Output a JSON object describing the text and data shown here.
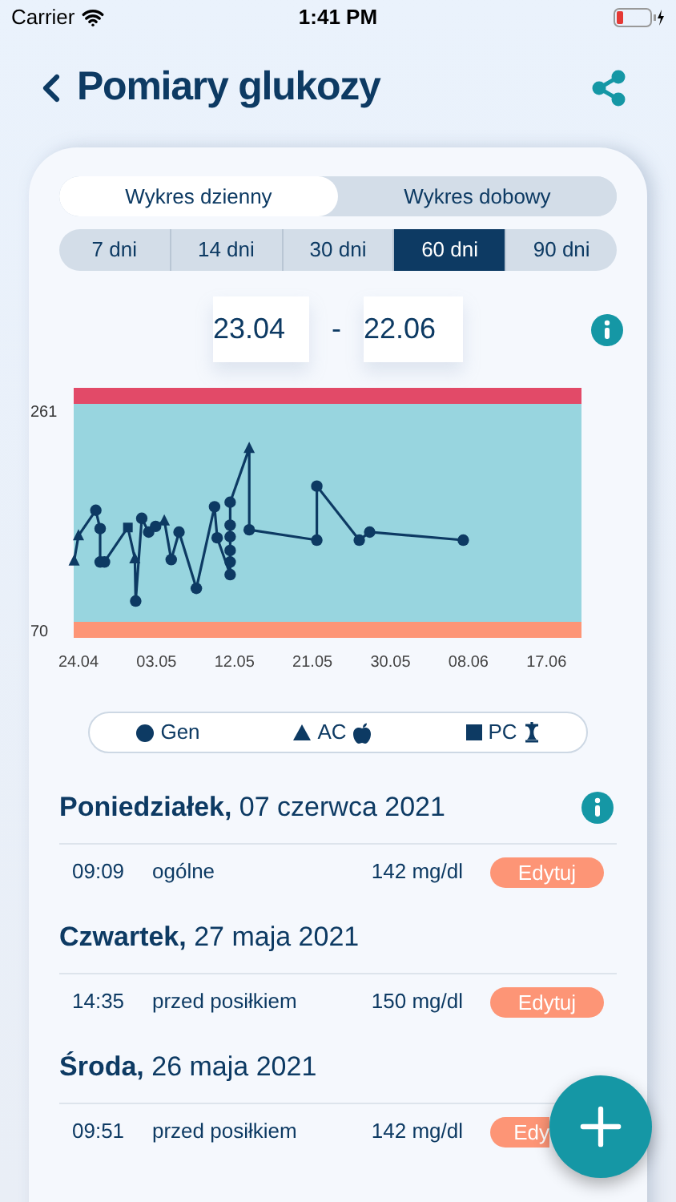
{
  "status_bar": {
    "carrier": "Carrier",
    "time": "1:41 PM"
  },
  "header": {
    "title": "Pomiary glukozy"
  },
  "chart_tabs": [
    {
      "label": "Wykres dzienny",
      "selected": true
    },
    {
      "label": "Wykres dobowy",
      "selected": false
    }
  ],
  "ranges": [
    {
      "label": "7 dni",
      "selected": false
    },
    {
      "label": "14 dni",
      "selected": false
    },
    {
      "label": "30 dni",
      "selected": false
    },
    {
      "label": "60 dni",
      "selected": true
    },
    {
      "label": "90 dni",
      "selected": false
    }
  ],
  "date_range": {
    "from": "23.04",
    "separator": "-",
    "to": "22.06"
  },
  "chart": {
    "y_labels": [
      "261",
      "70"
    ],
    "x_labels": [
      "24.04",
      "03.05",
      "12.05",
      "21.05",
      "30.05",
      "08.06",
      "17.06"
    ]
  },
  "legend": [
    {
      "kind": "circle",
      "label": "Gen"
    },
    {
      "kind": "triangle",
      "label": "AC"
    },
    {
      "kind": "square",
      "label": "PC"
    }
  ],
  "days": [
    {
      "title": "**Poniedziałek,** 07 czerwca 2021",
      "info": true,
      "entries": [
        {
          "time": "09:09",
          "type": "ogólne",
          "value": "142 mg/dl",
          "action": "Edytuj",
          "clipped": false
        }
      ]
    },
    {
      "title": "**Czwartek,** 27 maja 2021",
      "entries": [
        {
          "time": "14:35",
          "type": "przed posiłkiem",
          "value": "150 mg/dl",
          "action": "Edytuj",
          "clipped": false
        }
      ]
    },
    {
      "title": "**Środa,** 26 maja 2021",
      "entries": [
        {
          "time": "09:51",
          "type": "przed posiłkiem",
          "value": "142 mg/dl",
          "action": "Edy",
          "clipped": true
        }
      ]
    }
  ]
}
